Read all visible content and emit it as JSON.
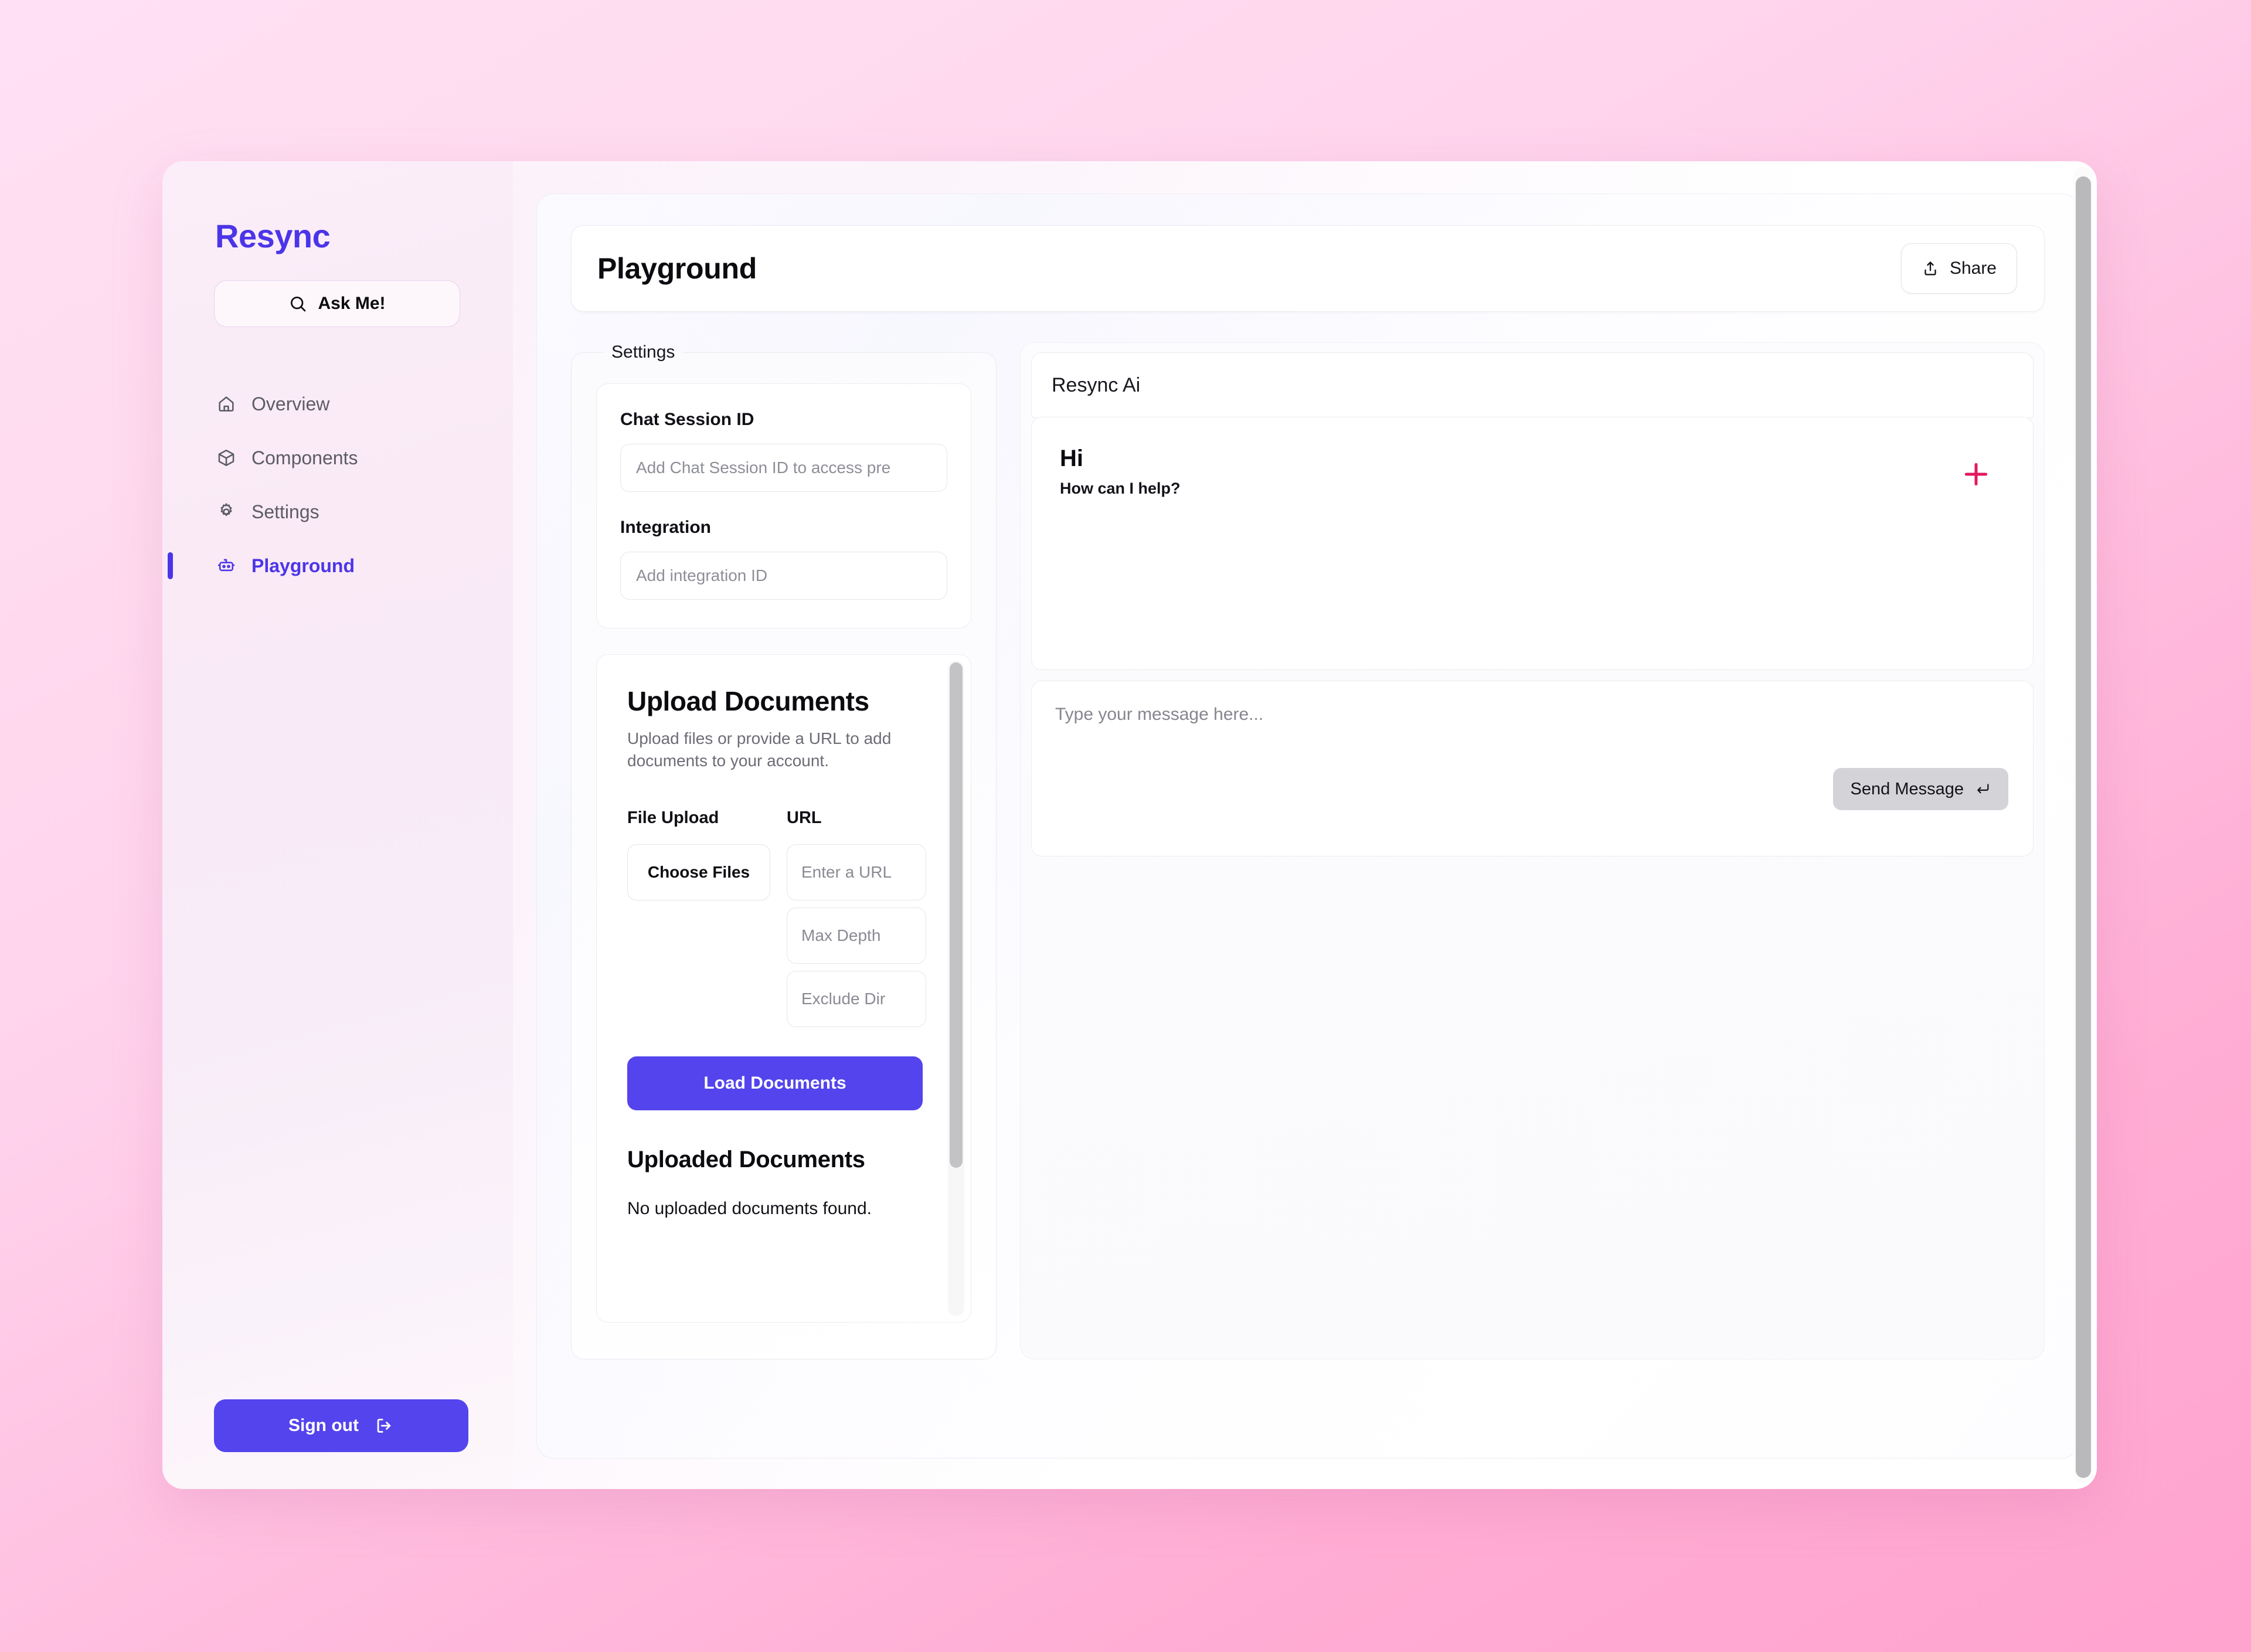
{
  "brand": {
    "name": "Resync",
    "color": "#4b35e8"
  },
  "sidebar": {
    "ask_button": {
      "label": "Ask Me!",
      "icon": "search-icon"
    },
    "items": [
      {
        "label": "Overview",
        "icon": "home-icon",
        "active": false
      },
      {
        "label": "Components",
        "icon": "cube-icon",
        "active": false
      },
      {
        "label": "Settings",
        "icon": "gear-icon",
        "active": false
      },
      {
        "label": "Playground",
        "icon": "robot-icon",
        "active": true
      }
    ],
    "sign_out": {
      "label": "Sign out",
      "icon": "logout-icon"
    }
  },
  "header": {
    "title": "Playground",
    "share": {
      "label": "Share",
      "icon": "share-icon"
    }
  },
  "settings": {
    "legend": "Settings",
    "chat_session": {
      "label": "Chat Session ID",
      "placeholder": "Add Chat Session ID to access pre",
      "value": ""
    },
    "integration": {
      "label": "Integration",
      "placeholder": "Add integration ID",
      "value": ""
    }
  },
  "upload": {
    "title": "Upload Documents",
    "description": "Upload files or provide a URL to add documents to your account.",
    "file_upload_label": "File Upload",
    "choose_files_label": "Choose Files",
    "url_label": "URL",
    "url_placeholder": "Enter a URL",
    "max_depth_placeholder": "Max Depth",
    "exclude_dirs_placeholder": "Exclude Dir",
    "load_button": "Load Documents",
    "uploaded_title": "Uploaded Documents",
    "uploaded_empty": "No uploaded documents found."
  },
  "chat": {
    "assistant_name": "Resync Ai",
    "greeting_title": "Hi",
    "greeting_sub": "How can I help?",
    "new_chat_icon": "plus-icon",
    "new_chat_color": "#e4185f",
    "composer_placeholder": "Type your message here...",
    "composer_value": "",
    "send_button": {
      "label": "Send Message",
      "icon": "enter-return-icon"
    }
  },
  "theme": {
    "accent": "#5344ed",
    "brand_text": "#4b35e8",
    "page_bg_start": "#ffe0f4",
    "page_bg_end": "#ffa3cf"
  }
}
